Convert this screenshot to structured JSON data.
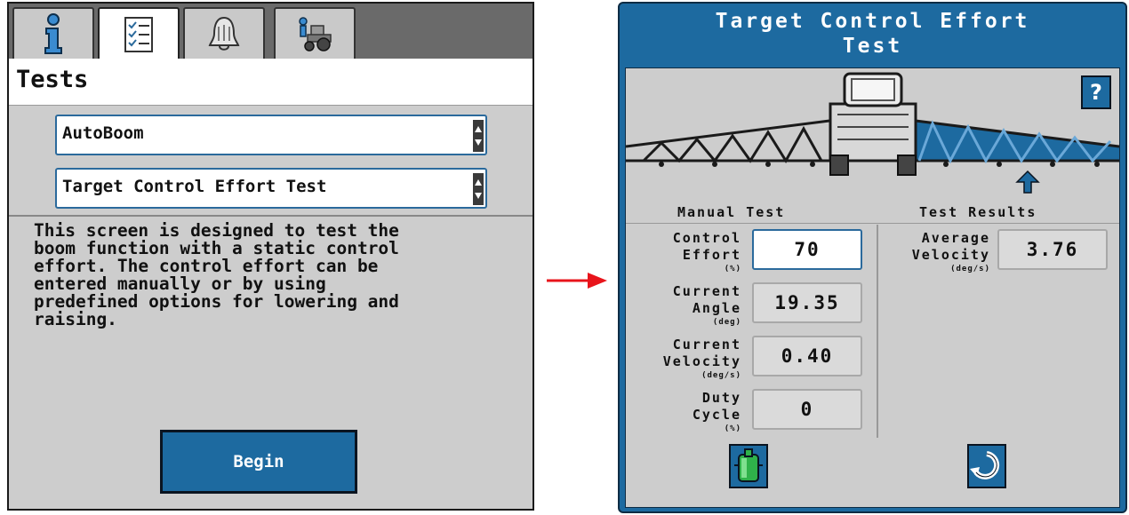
{
  "left_panel": {
    "tabs": [
      {
        "icon": "info-icon",
        "active": false
      },
      {
        "icon": "checklist-icon",
        "active": true
      },
      {
        "icon": "alarm-bell-icon",
        "active": false
      },
      {
        "icon": "tractor-icon",
        "active": false
      }
    ],
    "title": "Tests",
    "system_select": {
      "value": "AutoBoom"
    },
    "test_select": {
      "value": "Target Control Effort Test"
    },
    "description": "This screen is designed to test the\nboom function with a static control\neffort. The control effort can be\nentered manually or by using\npredefined options for lowering and\nraising.",
    "begin_label": "Begin"
  },
  "arrow": {
    "color": "#e8141b"
  },
  "right_panel": {
    "title_line1": "Target Control Effort",
    "title_line2": "Test",
    "help_label": "?",
    "manual_test_heading": "Manual Test",
    "test_results_heading": "Test Results",
    "fields": {
      "control_effort": {
        "label1": "Control",
        "label2": "Effort",
        "unit": "(%)",
        "value": "70"
      },
      "current_angle": {
        "label1": "Current",
        "label2": "Angle",
        "unit": "(deg)",
        "value": "19.35"
      },
      "current_velocity": {
        "label1": "Current",
        "label2": "Velocity",
        "unit": "(deg/s)",
        "value": "0.40"
      },
      "duty_cycle": {
        "label1": "Duty",
        "label2": "Cycle",
        "unit": "(%)",
        "value": "0"
      },
      "average_velocity": {
        "label1": "Average",
        "label2": "Velocity",
        "unit": "(deg/s)",
        "value": "3.76"
      }
    },
    "buttons": [
      {
        "icon": "cylinder-valve-icon"
      },
      {
        "icon": "reset-icon"
      }
    ]
  },
  "colors": {
    "accent_blue": "#1d6aa0",
    "panel_gray": "#cdcdcd",
    "arrow_red": "#e8141b"
  }
}
